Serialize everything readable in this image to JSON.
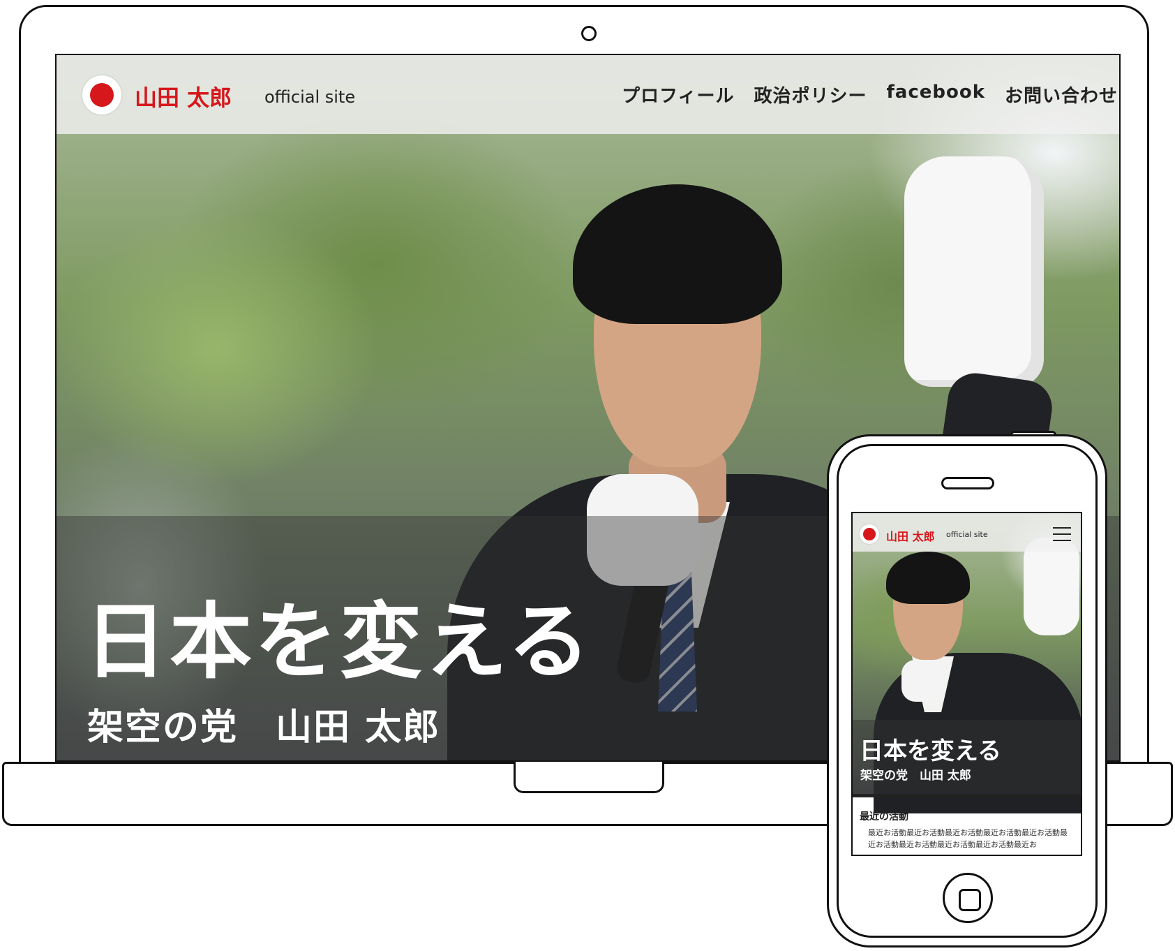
{
  "desktop": {
    "header": {
      "site_name": "山田 太郎",
      "site_sub": "official site",
      "nav": [
        "プロフィール",
        "政治ポリシー",
        "facebook",
        "お問い合わせ"
      ]
    },
    "hero": {
      "headline": "日本を変える",
      "subline": "架空の党　山田 太郎"
    }
  },
  "mobile": {
    "header": {
      "site_name": "山田 太郎",
      "site_sub": "official site"
    },
    "hero": {
      "headline": "日本を変える",
      "subline": "架空の党　山田 太郎"
    },
    "section": {
      "title": "最近の活動",
      "body": "最近お活動最近お活動最近お活動最近お活動最近お活動最近お活動最近お活動最近お活動最近お活動最近お"
    }
  },
  "colors": {
    "brand_red": "#d6171c",
    "header_bg": "#f0f0f0",
    "text_dark": "#222222"
  }
}
